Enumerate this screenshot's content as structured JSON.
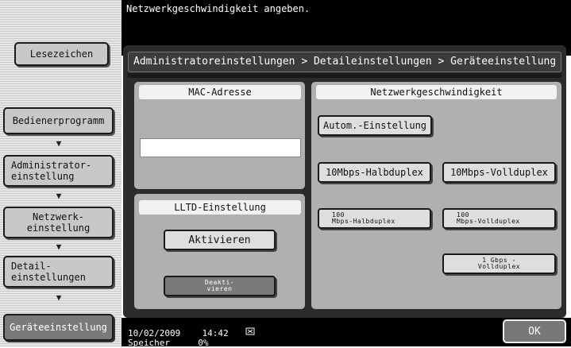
{
  "header": {
    "message": "Netzwerkgeschwindigkeit angeben.",
    "breadcrumb": "Administratoreinstellungen > Detaileinstellungen > Geräteeinstellung"
  },
  "sidebar": {
    "bookmark_label": "Lesezeichen",
    "steps": [
      {
        "label": "Bedienerprogramm"
      },
      {
        "line1": "Administrator-",
        "line2": "einstellung"
      },
      {
        "line1": "Netzwerk-",
        "line2": "einstellung"
      },
      {
        "line1": "Detail-",
        "line2": "einstellungen"
      },
      {
        "label": "Geräteeinstellung"
      }
    ]
  },
  "mac": {
    "title": "MAC-Adresse",
    "value": ""
  },
  "lltd": {
    "title": "LLTD-Einstellung",
    "activate_label": "Aktivieren",
    "deactivate_line1": "Deakti-",
    "deactivate_line2": "vieren"
  },
  "speed": {
    "title": "Netzwerkgeschwindigkeit",
    "auto_label": "Autom.-Einstellung",
    "half10": "10Mbps-Halbduplex",
    "full10": "10Mbps-Vollduplex",
    "half100_line1": "100",
    "half100_line2": "Mbps-Halbduplex",
    "full100_line1": "100",
    "full100_line2": "Mbps-Vollduplex",
    "full1g_line1": "1 Gbps -",
    "full1g_line2": "Vollduplex"
  },
  "footer": {
    "date": "10/02/2009",
    "time": "14:42",
    "memory_label": "Speicher",
    "memory_value": "0%",
    "ok_label": "OK"
  },
  "colors": {
    "accent_dark": "#7a7a7a",
    "section_bg": "#b0b0b0"
  }
}
